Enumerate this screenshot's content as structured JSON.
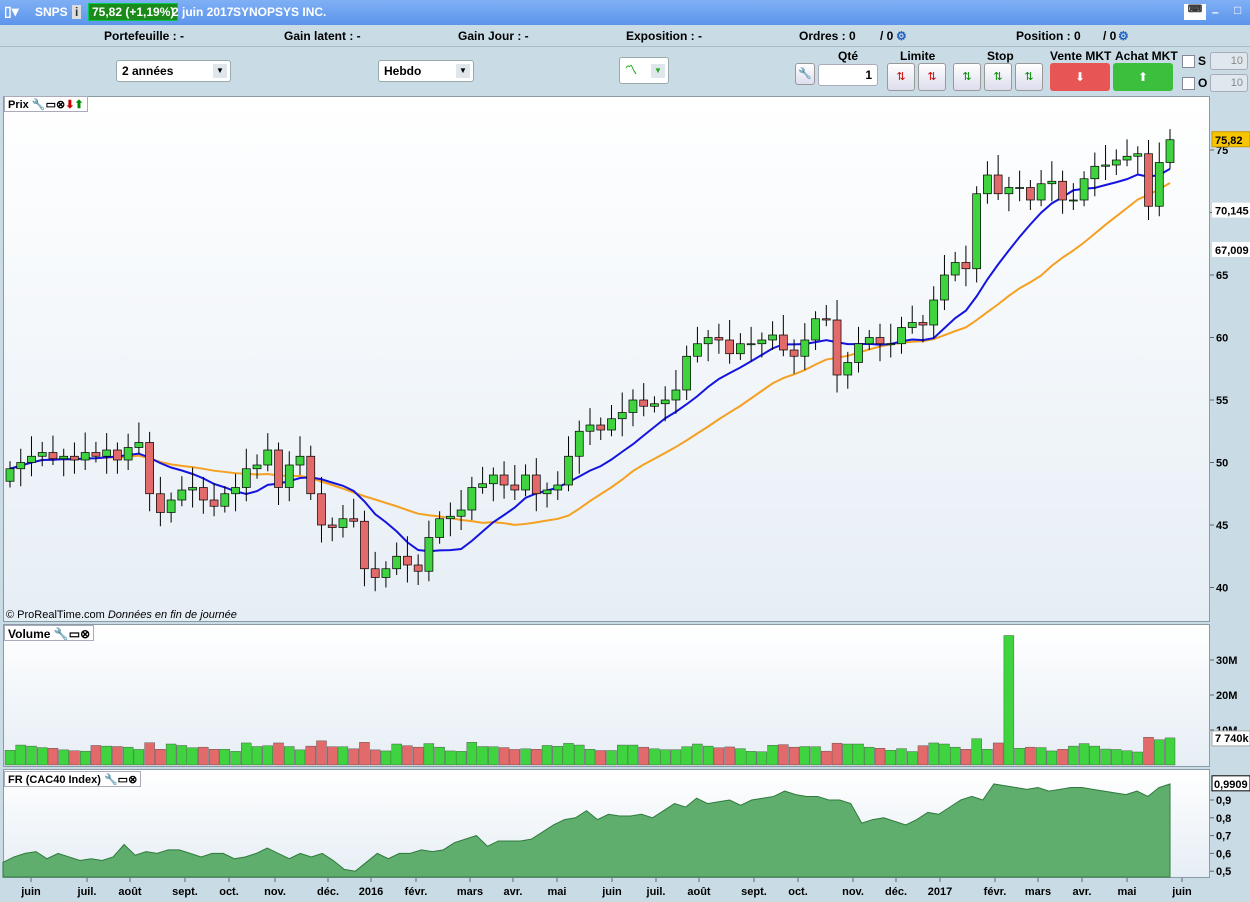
{
  "titlebar": {
    "symbol": "SNPS",
    "price_change": "75,82 (+1,19%)",
    "date": "2 juin 2017",
    "company": "SYNOPSYS INC."
  },
  "inforow": {
    "portefeuille": "Portefeuille : -",
    "gain_latent": "Gain latent : -",
    "gain_jour": "Gain Jour : -",
    "exposition": "Exposition : -",
    "ordres": "Ordres : 0",
    "ordres2": "/ 0",
    "position": "Position : 0",
    "position2": "/ 0"
  },
  "toolbar": {
    "period": "2 années",
    "interval": "Hebdo",
    "qty_label": "Qté",
    "qty_value": "1",
    "limite": "Limite",
    "stop": "Stop",
    "vente": "Vente MKT",
    "achat": "Achat MKT",
    "s_label": "S",
    "o_label": "O",
    "s_value": "10",
    "o_value": "10"
  },
  "panels": {
    "price": "Prix",
    "volume": "Volume",
    "cac": "FR (CAC40 Index)",
    "copyright": "© ProRealTime.com",
    "eod": "Données en fin de journée"
  },
  "colors": {
    "up": "#3fd33f",
    "down": "#e26a6a",
    "ma_fast": "#1414e0",
    "ma_slow": "#f5a020"
  },
  "chart_data": [
    {
      "type": "candlestick",
      "title": "Prix",
      "period": "weekly",
      "ylim": [
        38,
        77
      ],
      "yticks": [
        40,
        45,
        50,
        55,
        60,
        65,
        70,
        75
      ],
      "closes": [
        49.5,
        50,
        50.5,
        50.8,
        50.3,
        50.5,
        50.2,
        50.8,
        50.5,
        51,
        50.2,
        51.2,
        51.6,
        47.5,
        46,
        47,
        47.8,
        48,
        47,
        46.5,
        47.5,
        48,
        49.5,
        49.8,
        51,
        48,
        49.8,
        50.5,
        47.5,
        45,
        44.8,
        45.5,
        45.3,
        41.5,
        40.8,
        41.5,
        42.5,
        41.8,
        41.3,
        44,
        45.5,
        45.7,
        46.2,
        48,
        48.3,
        49,
        48.2,
        47.8,
        49,
        47.5,
        47.8,
        48.2,
        50.5,
        52.5,
        53,
        52.6,
        53.5,
        54,
        55,
        54.5,
        54.7,
        55,
        55.8,
        58.5,
        59.5,
        60,
        59.8,
        58.7,
        59.5,
        59.5,
        59.8,
        60.2,
        59,
        58.5,
        59.8,
        61.5,
        61.4,
        57,
        58,
        59.5,
        60,
        59.5,
        59.5,
        60.8,
        61.2,
        61,
        63,
        65,
        66,
        65.5,
        71.5,
        73,
        71.5,
        72,
        72,
        71,
        72.3,
        72.5,
        71,
        71,
        72.7,
        73.7,
        73.8,
        74.2,
        74.5,
        74.7,
        70.5,
        74,
        75.82
      ],
      "first_open": 48.5,
      "last_label": "75,82",
      "ma_fast_label": "70,145",
      "ma_slow_label": "67,009"
    },
    {
      "type": "bar",
      "title": "Volume",
      "yticks": [
        "10M",
        "20M",
        "30M"
      ],
      "ytick_values": [
        10,
        20,
        30
      ],
      "last_label": "7 740k",
      "spike_week": 93,
      "spike_value": 37,
      "last_value": 7.74
    },
    {
      "type": "area",
      "title": "FR (CAC40 Index)",
      "ylim": [
        0.48,
        1.02
      ],
      "yticks": [
        "0,5",
        "0,6",
        "0,7",
        "0,8",
        "0,9"
      ],
      "ytick_values": [
        0.5,
        0.6,
        0.7,
        0.8,
        0.9
      ],
      "last_label": "0,9909",
      "values": [
        0.55,
        0.58,
        0.6,
        0.61,
        0.57,
        0.6,
        0.58,
        0.56,
        0.57,
        0.56,
        0.58,
        0.65,
        0.59,
        0.61,
        0.6,
        0.62,
        0.62,
        0.6,
        0.58,
        0.6,
        0.6,
        0.57,
        0.58,
        0.6,
        0.63,
        0.6,
        0.57,
        0.6,
        0.58,
        0.6,
        0.56,
        0.51,
        0.5,
        0.55,
        0.6,
        0.57,
        0.6,
        0.6,
        0.62,
        0.61,
        0.62,
        0.66,
        0.68,
        0.7,
        0.64,
        0.67,
        0.67,
        0.67,
        0.68,
        0.72,
        0.76,
        0.79,
        0.8,
        0.84,
        0.79,
        0.82,
        0.81,
        0.81,
        0.82,
        0.8,
        0.84,
        0.88,
        0.86,
        0.91,
        0.88,
        0.89,
        0.9,
        0.87,
        0.9,
        0.91,
        0.92,
        0.95,
        0.93,
        0.92,
        0.92,
        0.9,
        0.9,
        0.88,
        0.77,
        0.79,
        0.8,
        0.78,
        0.76,
        0.79,
        0.83,
        0.82,
        0.86,
        0.9,
        0.92,
        0.9,
        0.99,
        0.98,
        0.97,
        0.96,
        0.97,
        0.95,
        0.96,
        0.97,
        0.97,
        0.96,
        0.95,
        0.94,
        0.93,
        0.95,
        0.92,
        0.97,
        0.99
      ]
    },
    {
      "type": "axis",
      "months": [
        "juin",
        "juil.",
        "août",
        "sept.",
        "oct.",
        "nov.",
        "déc.",
        "2016",
        "févr.",
        "mars",
        "avr.",
        "mai",
        "juin",
        "juil.",
        "août",
        "sept.",
        "oct.",
        "nov.",
        "déc.",
        "2017",
        "févr.",
        "mars",
        "avr.",
        "mai",
        "juin"
      ]
    }
  ]
}
